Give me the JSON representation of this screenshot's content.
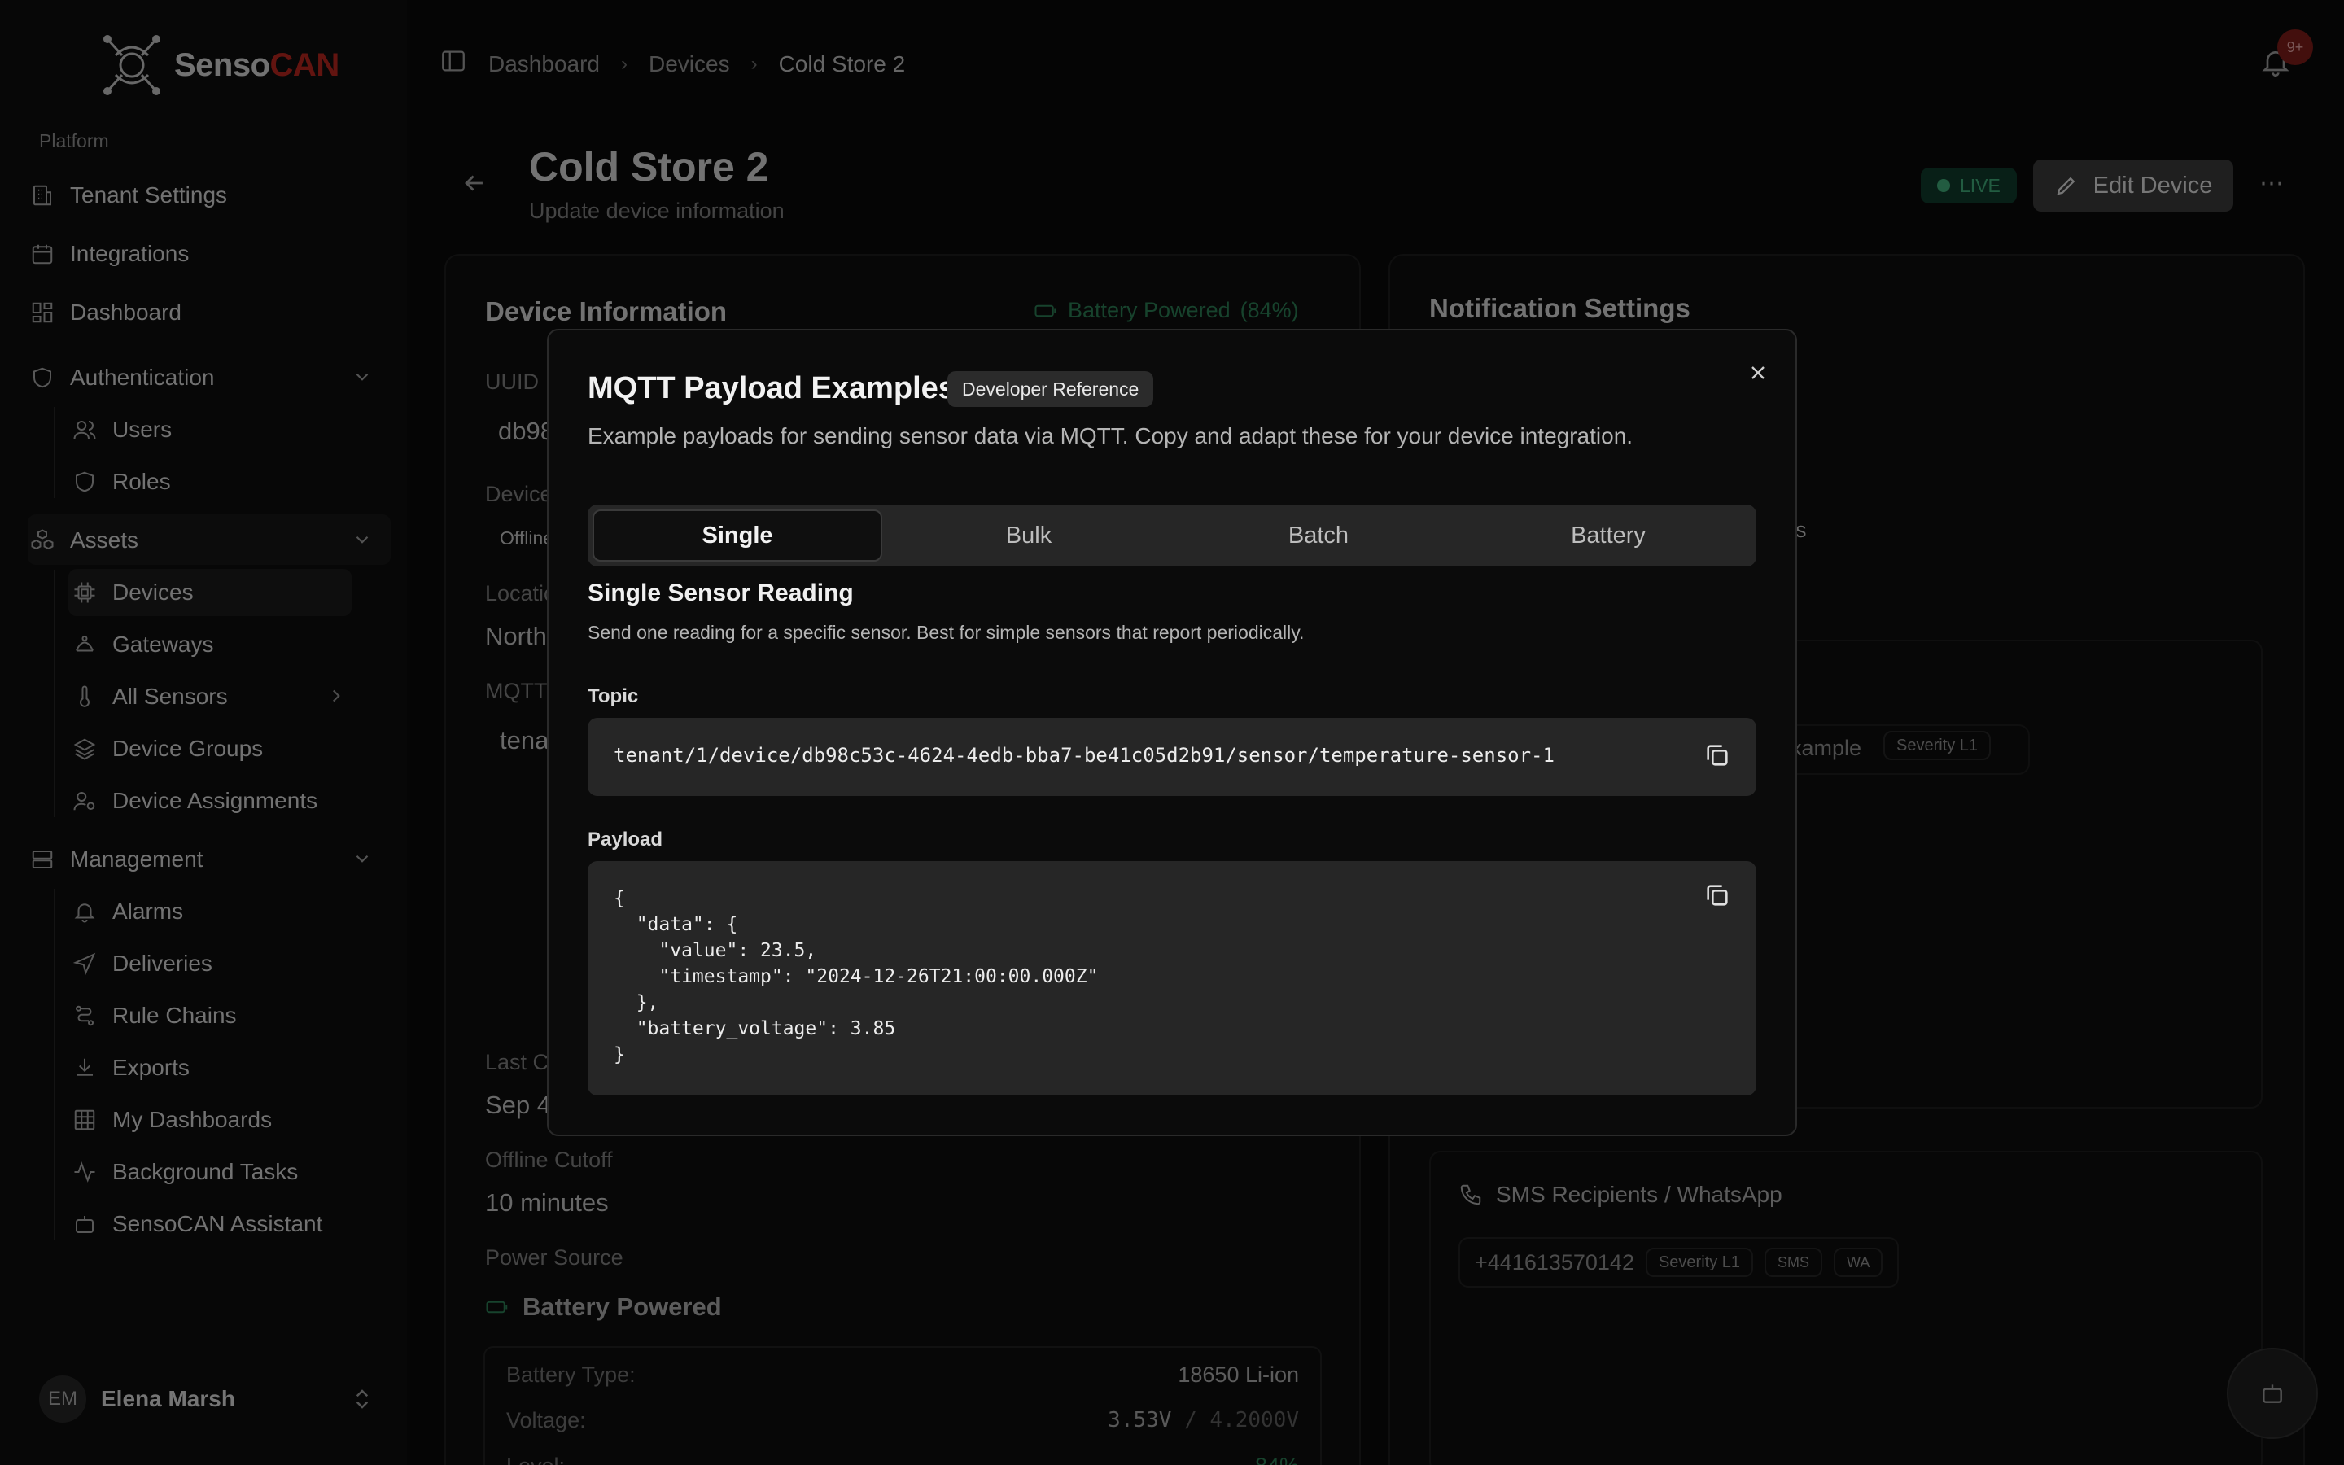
{
  "brand": {
    "name_part1": "Senso",
    "name_part2": "CAN",
    "accent_color": "#b3261e"
  },
  "sidebar": {
    "platform_label": "Platform",
    "items": [
      {
        "label": "Tenant Settings",
        "icon": "building-icon"
      },
      {
        "label": "Integrations",
        "icon": "calendar-icon"
      },
      {
        "label": "Dashboard",
        "icon": "dashboard-icon"
      }
    ],
    "authentication": {
      "label": "Authentication",
      "children": [
        {
          "label": "Users"
        },
        {
          "label": "Roles"
        }
      ]
    },
    "assets": {
      "label": "Assets",
      "children": [
        {
          "label": "Devices"
        },
        {
          "label": "Gateways"
        },
        {
          "label": "All Sensors"
        },
        {
          "label": "Device Groups"
        },
        {
          "label": "Device Assignments"
        }
      ]
    },
    "management": {
      "label": "Management",
      "children": [
        {
          "label": "Alarms"
        },
        {
          "label": "Deliveries"
        },
        {
          "label": "Rule Chains"
        },
        {
          "label": "Exports"
        },
        {
          "label": "My Dashboards"
        },
        {
          "label": "Background Tasks"
        },
        {
          "label": "SensoCAN Assistant"
        }
      ]
    },
    "user": {
      "initials": "EM",
      "name": "Elena Marsh"
    }
  },
  "header": {
    "breadcrumb": [
      "Dashboard",
      "Devices",
      "Cold Store 2"
    ],
    "notification_badge": "9+"
  },
  "page": {
    "title": "Cold Store 2",
    "subtitle": "Update device information",
    "live_label": "LIVE",
    "edit_label": "Edit Device"
  },
  "device_info": {
    "title": "Device Information",
    "battery_status": "Battery Powered",
    "battery_percent": "(84%)",
    "uuid_label": "UUID",
    "uuid_partial": "db98",
    "device_label_partial": "Device",
    "status_partial": "Offline",
    "location_label_partial": "Location",
    "location_partial": "North",
    "mqtt_label_partial": "MQTT",
    "mqtt_partial": "tena",
    "last_label_partial": "Last C",
    "last_partial": "Sep 4",
    "offline_cutoff_label": "Offline Cutoff",
    "offline_cutoff_value": "10 minutes",
    "power_source_label": "Power Source",
    "power_source_value": "Battery Powered",
    "battery_type_label": "Battery Type:",
    "battery_type_value": "18650 Li-ion",
    "voltage_label": "Voltage:",
    "voltage_value": "3.53V",
    "voltage_max": "/ 4.2000V",
    "level_label_partial": "Level:",
    "level_value_partial": "84%"
  },
  "notifications": {
    "title": "Notification Settings",
    "partial_text": "s",
    "email_partial": "xample",
    "email_severity": "Severity L1",
    "sms_title": "SMS Recipients / WhatsApp",
    "sms_number": "+441613570142",
    "sms_severity": "Severity L1",
    "sms_tag": "SMS",
    "wa_tag": "WA"
  },
  "modal": {
    "title": "MQTT Payload Examples",
    "badge": "Developer Reference",
    "description": "Example payloads for sending sensor data via MQTT. Copy and adapt these for your device integration.",
    "tabs": [
      "Single",
      "Bulk",
      "Batch",
      "Battery"
    ],
    "active_tab": "Single",
    "section_title": "Single Sensor Reading",
    "section_desc": "Send one reading for a specific sensor. Best for simple sensors that report periodically.",
    "topic_label": "Topic",
    "topic_value": "tenant/1/device/db98c53c-4624-4edb-bba7-be41c05d2b91/sensor/temperature-sensor-1",
    "payload_label": "Payload",
    "payload_value": "{\n  \"data\": {\n    \"value\": 23.5,\n    \"timestamp\": \"2024-12-26T21:00:00.000Z\"\n  },\n  \"battery_voltage\": 3.85\n}"
  }
}
